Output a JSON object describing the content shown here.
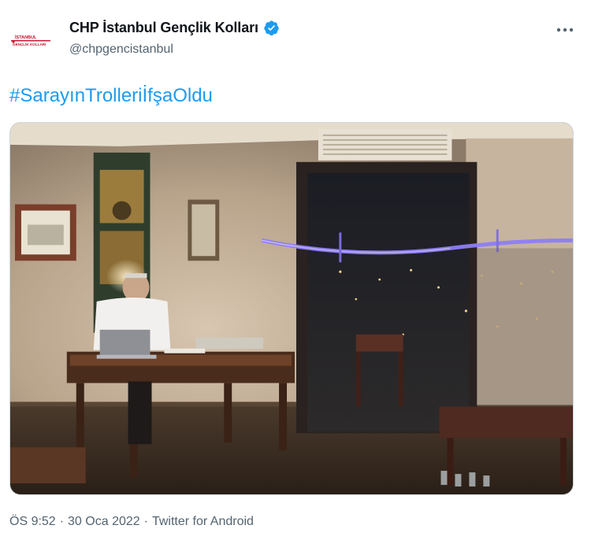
{
  "author": {
    "display_name": "CHP İstanbul Gençlik Kolları",
    "handle": "@chpgencistanbul",
    "avatar_icon": "chp-istanbul-youth-logo",
    "avatar_text_line1": "İSTANBUL",
    "avatar_text_line2": "GENÇLİK KOLLARI",
    "verified_icon": "verified-badge-icon",
    "verified_color": "#1d9bf0"
  },
  "menu": {
    "more_icon": "more-horizontal-icon"
  },
  "tweet": {
    "hashtag": "#SarayınTrolleriİfşaOldu",
    "hashtag_color": "#1d9bf0"
  },
  "media": {
    "description_icon": "photo"
  },
  "meta": {
    "time": "ÖS 9:52",
    "separator1": "·",
    "date": "30 Oca 2022",
    "separator2": "·",
    "source": "Twitter for Android"
  }
}
